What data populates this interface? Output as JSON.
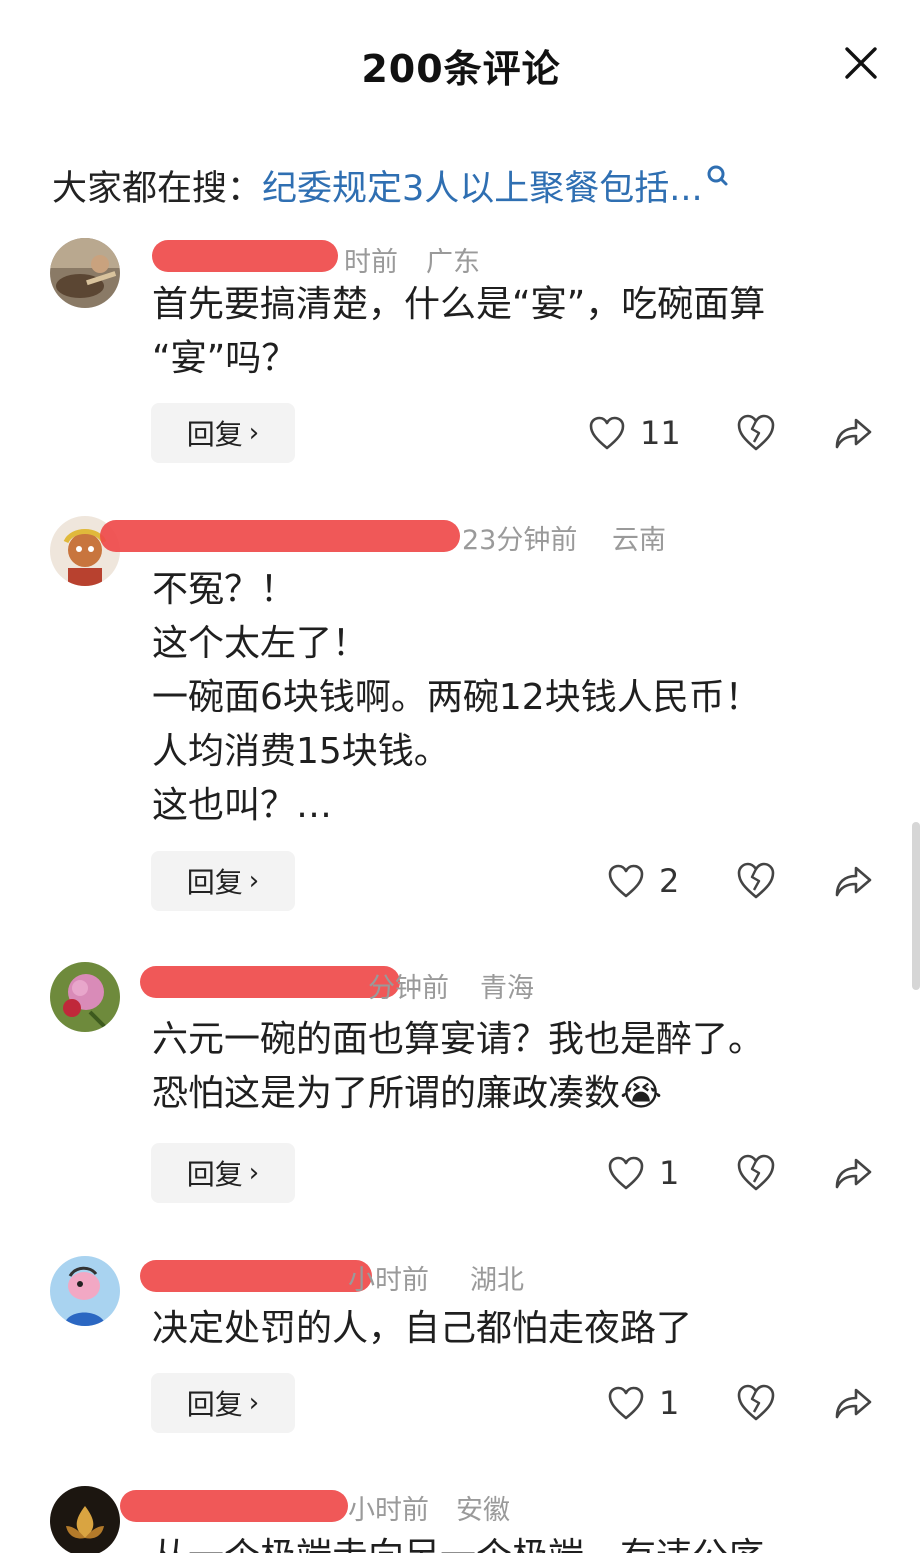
{
  "header": {
    "title": "200条评论",
    "close_icon": "close-icon"
  },
  "search": {
    "prefix": "大家都在搜：",
    "query": "纪委规定3人以上聚餐包括...",
    "icon": "search-icon"
  },
  "reply_label": "回复",
  "reply_chevron": "›",
  "colors": {
    "accent_link": "#2f6fb2",
    "redaction": "#ef4a4a",
    "meta_gray": "#9a9a9a",
    "reply_bg": "#f3f3f3"
  },
  "comments": [
    {
      "meta_time": "时前",
      "location": "广东",
      "lines": [
        "首先要搞清楚，什么是“宴”，吃碗面算",
        "“宴”吗？"
      ],
      "likes": "11"
    },
    {
      "meta_time": "23分钟前",
      "location": "云南",
      "lines": [
        "不冤？！",
        "这个太左了！",
        "一碗面6块钱啊。两碗12块钱人民币！",
        "人均消费15块钱。",
        "这也叫？…"
      ],
      "likes": "2"
    },
    {
      "meta_time": "分钟前",
      "location": "青海",
      "lines": [
        "六元一碗的面也算宴请？我也是醉了。",
        "恐怕这是为了所谓的廉政凑数"
      ],
      "emoji": "😭",
      "likes": "1"
    },
    {
      "meta_time": "小时前",
      "location": "湖北",
      "lines": [
        "决定处罚的人，自己都怕走夜路了"
      ],
      "likes": "1"
    },
    {
      "meta_time": "小时前",
      "location": "安徽",
      "lines": [
        "从一个极端走向另一个极端，有违公序"
      ]
    }
  ]
}
